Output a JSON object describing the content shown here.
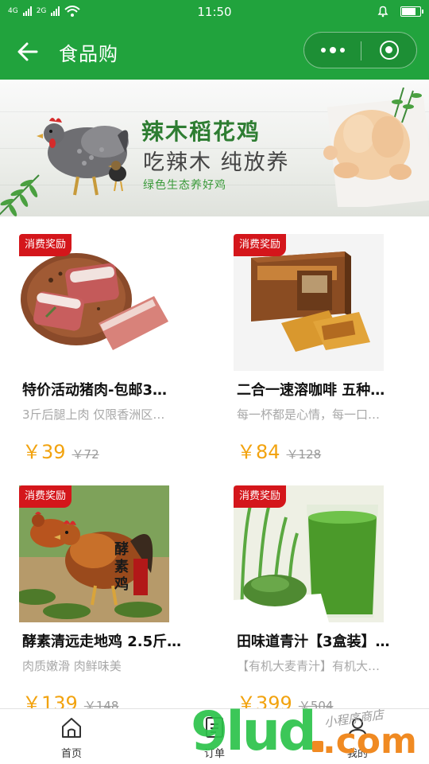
{
  "status_bar": {
    "time": "11:50",
    "signal_label_1": "4G",
    "signal_label_2": "2G",
    "battery_level": 0.8
  },
  "nav": {
    "title": "食品购",
    "back_icon": "arrow-left-icon",
    "menu_icon": "more-dots-icon",
    "close_icon": "target-circle-icon"
  },
  "banner": {
    "title": "辣木稻花鸡",
    "subtitle": "吃辣木 纯放养",
    "tagline": "绿色生态养好鸡"
  },
  "products": [
    {
      "badge": "消费奖励",
      "name": "特价活动猪肉-包邮3…",
      "desc": "3斤后腿上肉 仅限香洲区…",
      "price": "￥39",
      "original_price": "￥72",
      "image": "pork-image"
    },
    {
      "badge": "消费奖励",
      "name": "二合一速溶咖啡 五种…",
      "desc": "每一杯都是心情，每一口…",
      "price": "￥84",
      "original_price": "￥128",
      "image": "coffee-box-image"
    },
    {
      "badge": "消费奖励",
      "name": "酵素清远走地鸡 2.5斤…",
      "desc": "肉质嫩滑 肉鲜味美",
      "price": "￥139",
      "original_price": "￥148",
      "image": "free-range-chicken-image",
      "image_text": "酵素鸡"
    },
    {
      "badge": "消费奖励",
      "name": "田味道青汁【3盒装】…",
      "desc": "【有机大麦青汁】有机大…",
      "price": "￥399",
      "original_price": "￥504",
      "image": "green-juice-image"
    }
  ],
  "tabbar": [
    {
      "label": "首页",
      "icon": "home-icon"
    },
    {
      "label": "订单",
      "icon": "order-list-icon"
    },
    {
      "label": "我的",
      "icon": "user-icon"
    }
  ],
  "watermark": {
    "digits": "9lud",
    "domain": ".com",
    "script": "小程序商店"
  },
  "colors": {
    "brand_green": "#21a33d",
    "price_orange": "#f2a30f",
    "badge_red": "#d4161b"
  }
}
